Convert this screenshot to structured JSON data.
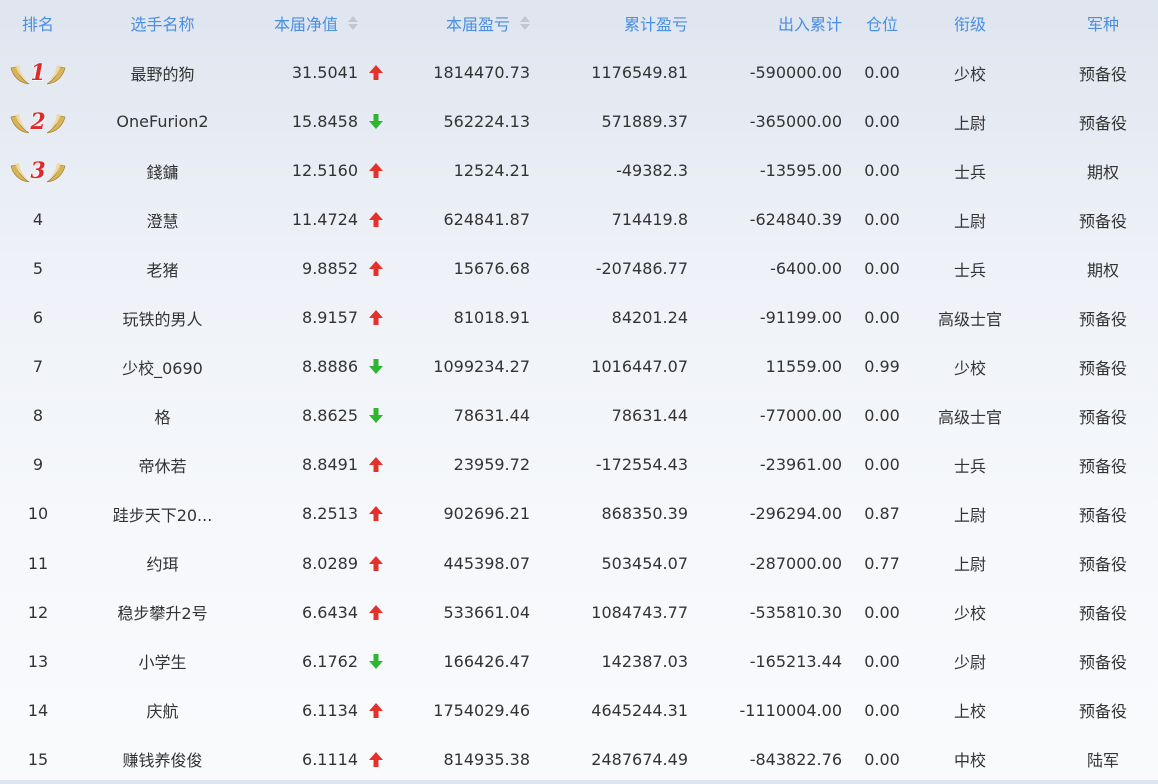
{
  "header": {
    "rank": "排名",
    "name": "选手名称",
    "nav": "本届净值",
    "pnl": "本届盈亏",
    "total_pnl": "累计盈亏",
    "flow": "出入累计",
    "position": "仓位",
    "grade": "衔级",
    "branch": "军种"
  },
  "rows": [
    {
      "rank": "1",
      "name": "最野的狗",
      "nav": "31.5041",
      "trend": "up",
      "pnl": "1814470.73",
      "total_pnl": "1176549.81",
      "flow": "-590000.00",
      "position": "0.00",
      "grade": "少校",
      "branch": "预备役"
    },
    {
      "rank": "2",
      "name": "OneFurion2",
      "nav": "15.8458",
      "trend": "down",
      "pnl": "562224.13",
      "total_pnl": "571889.37",
      "flow": "-365000.00",
      "position": "0.00",
      "grade": "上尉",
      "branch": "预备役"
    },
    {
      "rank": "3",
      "name": "錢鏞",
      "nav": "12.5160",
      "trend": "up",
      "pnl": "12524.21",
      "total_pnl": "-49382.3",
      "flow": "-13595.00",
      "position": "0.00",
      "grade": "士兵",
      "branch": "期权"
    },
    {
      "rank": "4",
      "name": "澄慧",
      "nav": "11.4724",
      "trend": "up",
      "pnl": "624841.87",
      "total_pnl": "714419.8",
      "flow": "-624840.39",
      "position": "0.00",
      "grade": "上尉",
      "branch": "预备役"
    },
    {
      "rank": "5",
      "name": "老猪",
      "nav": "9.8852",
      "trend": "up",
      "pnl": "15676.68",
      "total_pnl": "-207486.77",
      "flow": "-6400.00",
      "position": "0.00",
      "grade": "士兵",
      "branch": "期权"
    },
    {
      "rank": "6",
      "name": "玩铁的男人",
      "nav": "8.9157",
      "trend": "up",
      "pnl": "81018.91",
      "total_pnl": "84201.24",
      "flow": "-91199.00",
      "position": "0.00",
      "grade": "高级士官",
      "branch": "预备役"
    },
    {
      "rank": "7",
      "name": "少校_0690",
      "nav": "8.8886",
      "trend": "down",
      "pnl": "1099234.27",
      "total_pnl": "1016447.07",
      "flow": "11559.00",
      "position": "0.99",
      "grade": "少校",
      "branch": "预备役"
    },
    {
      "rank": "8",
      "name": "格",
      "nav": "8.8625",
      "trend": "down",
      "pnl": "78631.44",
      "total_pnl": "78631.44",
      "flow": "-77000.00",
      "position": "0.00",
      "grade": "高级士官",
      "branch": "预备役"
    },
    {
      "rank": "9",
      "name": "帝休若",
      "nav": "8.8491",
      "trend": "up",
      "pnl": "23959.72",
      "total_pnl": "-172554.43",
      "flow": "-23961.00",
      "position": "0.00",
      "grade": "士兵",
      "branch": "预备役"
    },
    {
      "rank": "10",
      "name": "跬步天下20...",
      "nav": "8.2513",
      "trend": "up",
      "pnl": "902696.21",
      "total_pnl": "868350.39",
      "flow": "-296294.00",
      "position": "0.87",
      "grade": "上尉",
      "branch": "预备役"
    },
    {
      "rank": "11",
      "name": "约珥",
      "nav": "8.0289",
      "trend": "up",
      "pnl": "445398.07",
      "total_pnl": "503454.07",
      "flow": "-287000.00",
      "position": "0.77",
      "grade": "上尉",
      "branch": "预备役"
    },
    {
      "rank": "12",
      "name": "稳步攀升2号",
      "nav": "6.6434",
      "trend": "up",
      "pnl": "533661.04",
      "total_pnl": "1084743.77",
      "flow": "-535810.30",
      "position": "0.00",
      "grade": "少校",
      "branch": "预备役"
    },
    {
      "rank": "13",
      "name": "小学生",
      "nav": "6.1762",
      "trend": "down",
      "pnl": "166426.47",
      "total_pnl": "142387.03",
      "flow": "-165213.44",
      "position": "0.00",
      "grade": "少尉",
      "branch": "预备役"
    },
    {
      "rank": "14",
      "name": "庆航",
      "nav": "6.1134",
      "trend": "up",
      "pnl": "1754029.46",
      "total_pnl": "4645244.31",
      "flow": "-1110004.00",
      "position": "0.00",
      "grade": "上校",
      "branch": "预备役"
    },
    {
      "rank": "15",
      "name": "赚钱养俊俊",
      "nav": "6.1114",
      "trend": "up",
      "pnl": "814935.38",
      "total_pnl": "2487674.49",
      "flow": "-843822.76",
      "position": "0.00",
      "grade": "中校",
      "branch": "陆军"
    }
  ],
  "colors": {
    "header_text": "#4a8fe0",
    "up_arrow": "#e5312c",
    "down_arrow": "#2fb52f",
    "medal_number": "#e02a2a",
    "wing": "#c9a24a"
  },
  "icons": {
    "up": "arrow-up-icon",
    "down": "arrow-down-icon",
    "sort": "sort-icon",
    "medal": "laurel-medal-icon"
  }
}
